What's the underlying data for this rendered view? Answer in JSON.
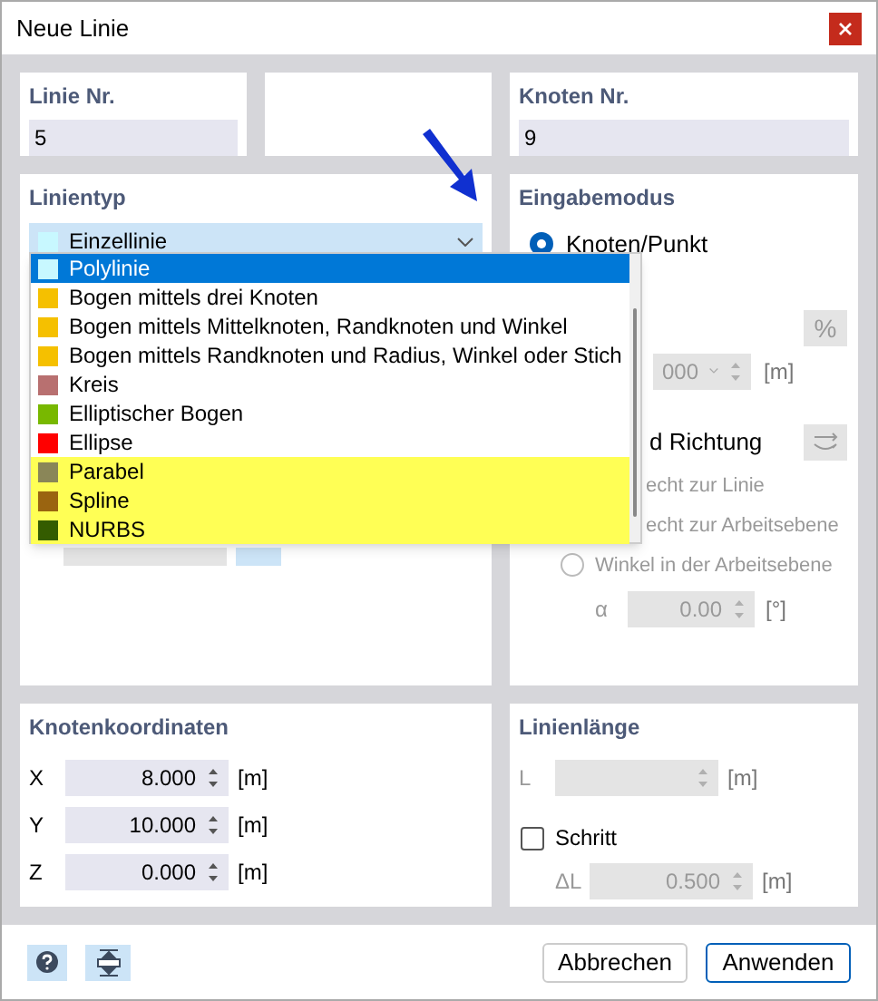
{
  "window": {
    "title": "Neue Linie"
  },
  "line_number": {
    "label": "Linie Nr.",
    "value": "5"
  },
  "node_number": {
    "label": "Knoten Nr.",
    "value": "9"
  },
  "line_type": {
    "label": "Linientyp",
    "value": "Einzellinie",
    "color": "#c8f8ff",
    "expanded": true,
    "options": [
      {
        "label": "Polylinie",
        "color": "#c8f8ff",
        "selected": true,
        "highlighted": false
      },
      {
        "label": "Bogen mittels drei Knoten",
        "color": "#f5c000",
        "selected": false,
        "highlighted": false
      },
      {
        "label": "Bogen mittels Mittelknoten, Randknoten und Winkel",
        "color": "#f5c000",
        "selected": false,
        "highlighted": false
      },
      {
        "label": "Bogen mittels Randknoten und Radius, Winkel oder Stich",
        "color": "#f5c000",
        "selected": false,
        "highlighted": false
      },
      {
        "label": "Kreis",
        "color": "#b87070",
        "selected": false,
        "highlighted": false
      },
      {
        "label": "Elliptischer Bogen",
        "color": "#78b800",
        "selected": false,
        "highlighted": false
      },
      {
        "label": "Ellipse",
        "color": "#ff0000",
        "selected": false,
        "highlighted": false
      },
      {
        "label": "Parabel",
        "color": "#8a8658",
        "selected": false,
        "highlighted": true
      },
      {
        "label": "Spline",
        "color": "#9a6410",
        "selected": false,
        "highlighted": true
      },
      {
        "label": "NURBS",
        "color": "#345c00",
        "selected": false,
        "highlighted": true
      }
    ]
  },
  "input_mode": {
    "title": "Eingabemodus",
    "node_point": {
      "label": "Knoten/Punkt",
      "selected": true
    },
    "percent_button": {
      "label": "%",
      "disabled": true
    },
    "length_field": {
      "value": "000",
      "unit": "[m]",
      "disabled": true
    },
    "direction_label": "d Richtung",
    "perpendicular_options": [
      {
        "label": "echt zur Linie"
      },
      {
        "label": "echt zur Arbeitsebene"
      }
    ],
    "angle_option": {
      "label": "Winkel in der Arbeitsebene",
      "selected": false,
      "disabled": true
    },
    "alpha": {
      "label": "α",
      "value": "0.00",
      "unit": "[°]",
      "disabled": true
    }
  },
  "node_coordinates": {
    "title": "Knotenkoordinaten",
    "rows": [
      {
        "label": "X",
        "value": "8.000",
        "unit": "[m]"
      },
      {
        "label": "Y",
        "value": "10.000",
        "unit": "[m]"
      },
      {
        "label": "Z",
        "value": "0.000",
        "unit": "[m]"
      }
    ]
  },
  "line_length": {
    "title": "Linienlänge",
    "length": {
      "label": "L",
      "unit": "[m]",
      "disabled": true
    },
    "step": {
      "label": "Schritt",
      "checked": false
    },
    "delta": {
      "label": "ΔL",
      "value": "0.500",
      "unit": "[m]",
      "disabled": true
    }
  },
  "buttons": [
    {
      "label": "Abbrechen",
      "default": false
    },
    {
      "label": "Anwenden",
      "default": true
    }
  ]
}
